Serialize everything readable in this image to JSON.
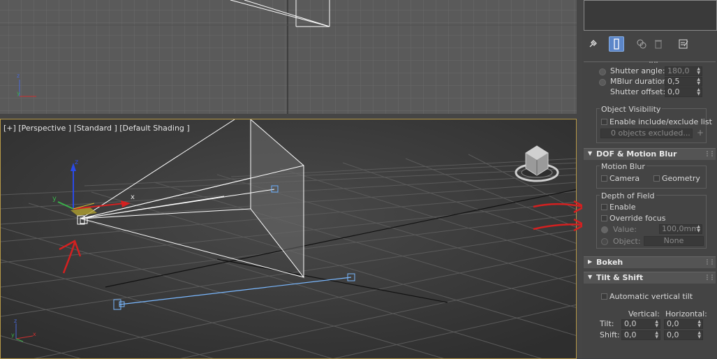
{
  "viewport_perspective": {
    "label_plus": "[+]",
    "label_view": "[Perspective ]",
    "label_mode": "[Standard ]",
    "label_shading": "[Default Shading ]"
  },
  "axis_labels": {
    "x": "x",
    "y": "y",
    "z": "z"
  },
  "panel": {
    "tabs": [
      "pin-icon",
      "modify-icon",
      "hierarchy-icon",
      "delete-icon",
      "configure-icon"
    ],
    "motion_blur_settings": {
      "shutter_angle_label": "Shutter angle:",
      "shutter_angle_value": "180,0",
      "mblur_duration_label": "MBlur duration:",
      "mblur_duration_value": "0,5",
      "shutter_offset_label": "Shutter offset:",
      "shutter_offset_value": "0,0"
    },
    "object_visibility": {
      "title": "Object Visibility",
      "enable_label": "Enable include/exclude list",
      "objects_excluded": "0 objects excluded...",
      "add_label": "+"
    },
    "dof_rollout": {
      "title": "DOF & Motion Blur",
      "motion_blur_title": "Motion Blur",
      "camera_label": "Camera",
      "geometry_label": "Geometry",
      "depth_of_field_title": "Depth of Field",
      "enable_label": "Enable",
      "override_focus_label": "Override focus",
      "value_label": "Value:",
      "value_value": "100,0mm",
      "object_label": "Object:",
      "object_value": "None"
    },
    "bokeh_rollout": {
      "title": "Bokeh"
    },
    "tilt_shift_rollout": {
      "title": "Tilt & Shift",
      "auto_vertical_tilt_label": "Automatic vertical tilt",
      "vertical_header": "Vertical:",
      "horizontal_header": "Horizontal:",
      "tilt_label": "Tilt:",
      "tilt_vertical": "0,0",
      "tilt_horizontal": "0,0",
      "shift_label": "Shift:",
      "shift_vertical": "0,0",
      "shift_horizontal": "0,0"
    }
  },
  "colors": {
    "active_viewport_border": "#b89a48",
    "annotation_red": "#d42020",
    "tab_active": "#5c86c8"
  }
}
